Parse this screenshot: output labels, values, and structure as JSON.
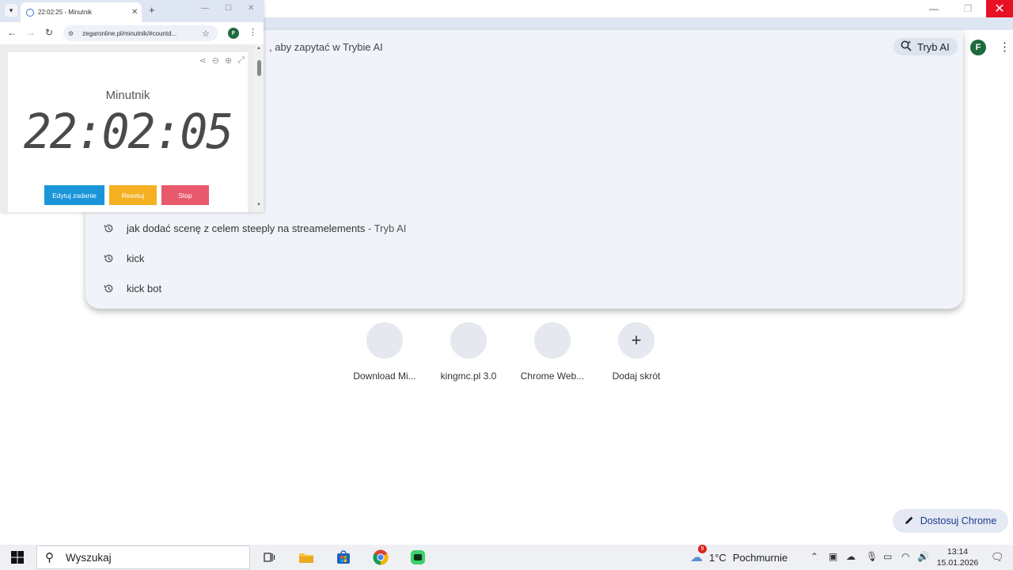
{
  "main_window": {
    "controls": {
      "minimize": "—",
      "maximize": "❐",
      "close": "✕"
    },
    "omnibox_hint": ", aby zapytać w Trybie AI",
    "ai_mode_chip": "Tryb AI",
    "avatar_letter": "F",
    "menu_icon": "⋮",
    "suggestions": [
      {
        "text": "jak dodać scenę z celem steeply na streamelements",
        "separator": " - ",
        "suffix": "Tryb AI"
      },
      {
        "text": "kick",
        "separator": "",
        "suffix": ""
      },
      {
        "text": "kick bot",
        "separator": "",
        "suffix": ""
      }
    ],
    "shortcuts": [
      {
        "label": "Download Mi..."
      },
      {
        "label": "kingmc.pl 3.0"
      },
      {
        "label": "Chrome Web..."
      },
      {
        "label": "Dodaj skrót",
        "icon": "+"
      }
    ],
    "customize_button": "Dostosuj Chrome"
  },
  "mini_window": {
    "tab_title": "22:02:25 - Minutnik",
    "url": "zegaronline.pl/minutnik/#countd...",
    "avatar_letter": "F",
    "timer": {
      "title": "Minutnik",
      "display": "22:02:05",
      "buttons": {
        "edit": "Edytuj zadanie",
        "reset": "Resetuj",
        "stop": "Stop"
      }
    }
  },
  "taskbar": {
    "search_placeholder": "Wyszukaj",
    "weather": {
      "temp": "1°C",
      "condition": "Pochmurnie",
      "badge": "9"
    },
    "clock": {
      "time": "13:14",
      "date": "15.01.2026"
    }
  },
  "colors": {
    "edit_button": "#1a95d9",
    "reset_button": "#f4b021",
    "stop_button": "#e8596b",
    "close_button": "#e81123",
    "avatar": "#1e6b3d"
  }
}
